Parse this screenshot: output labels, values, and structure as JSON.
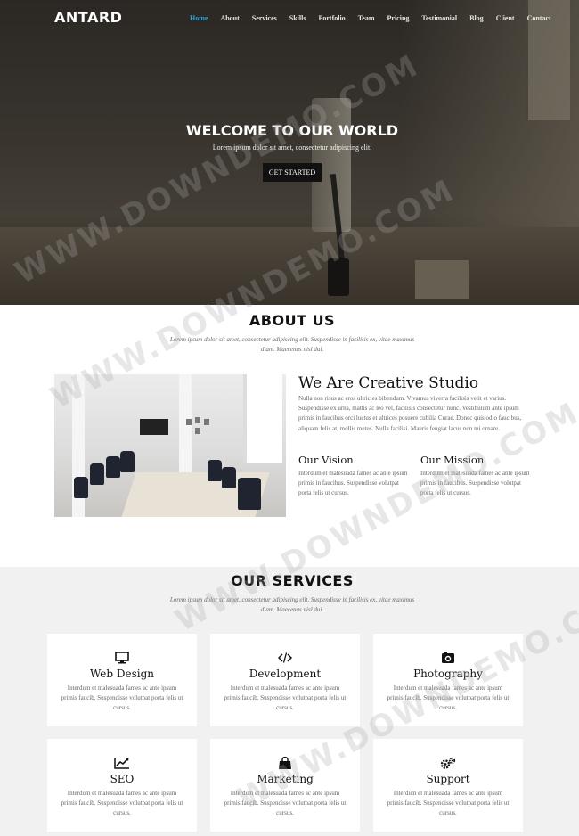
{
  "brand": {
    "logo": "ANTARD"
  },
  "nav": {
    "items": [
      "Home",
      "About",
      "Services",
      "Skills",
      "Portfolio",
      "Team",
      "Pricing",
      "Testimonial",
      "Blog",
      "Client",
      "Contact"
    ],
    "active": "Home",
    "active_color": "#2aa5d6"
  },
  "hero": {
    "title": "WELCOME TO OUR WORLD",
    "subtitle": "Lorem ipsum dolor sit amet, consectetur adipiscing elit.",
    "button": "GET STARTED"
  },
  "about": {
    "title": "ABOUT US",
    "subtitle": "Lorem ipsum dolor sit amet, consectetur adipiscing elit. Suspendisse in facilisis ex, vitae maximus diam. Maecenas nisl dui.",
    "heading": "We Are Creative Studio",
    "text": "Nulla non risus ac eros ultricies bibendum. Vivamus viverra facilisis velit et varius. Suspendisse ex urna, mattis ac leo vel, facilisis consectetur nunc. Vestibulum ante ipsum primis in faucibus orci luctus et ultrices posuere cubilia Curae. Donec quis odio faucibus, aliquam felis at, mollis metus. Nulla facilisi. Mauris feugiat lacus non mi ornare.",
    "vision": {
      "title": "Our Vision",
      "text": "Interdum et malesuada fames ac ante ipsum primis in faucibus. Suspendisse volutpat porta felis ut cursus."
    },
    "mission": {
      "title": "Our Mission",
      "text": "Interdum et malesuada fames ac ante ipsum primis in faucibus. Suspendisse volutpat porta felis ut cursus."
    }
  },
  "services": {
    "title": "OUR SERVICES",
    "subtitle": "Lorem ipsum dolor sit amet, consectetur adipiscing elit. Suspendisse in facilisis ex, vitae maximus diam. Maecenas nisl dui.",
    "cards": [
      {
        "icon": "desktop-icon",
        "title": "Web Design",
        "text": "Interdum et malesuada fames ac ante ipsum primis faucib. Suspendisse volutpat porta felis ut cursus."
      },
      {
        "icon": "code-icon",
        "title": "Development",
        "text": "Interdum et malesuada fames ac ante ipsum primis faucib. Suspendisse volutpat porta felis ut cursus."
      },
      {
        "icon": "camera-icon",
        "title": "Photography",
        "text": "Interdum et malesuada fames ac ante ipsum primis faucib. Suspendisse volutpat porta felis ut cursus."
      },
      {
        "icon": "line-chart-icon",
        "title": "SEO",
        "text": "Interdum et malesuada fames ac ante ipsum primis faucib. Suspendisse volutpat porta felis ut cursus."
      },
      {
        "icon": "shopping-bag-icon",
        "title": "Marketing",
        "text": "Interdum et malesuada fames ac ante ipsum primis faucib. Suspendisse volutpat porta felis ut cursus."
      },
      {
        "icon": "gears-icon",
        "title": "Support",
        "text": "Interdum et malesuada fames ac ante ipsum primis faucib. Suspendisse volutpat porta felis ut cursus."
      }
    ]
  },
  "watermark": "WWW.DOWNDEMO.COM"
}
